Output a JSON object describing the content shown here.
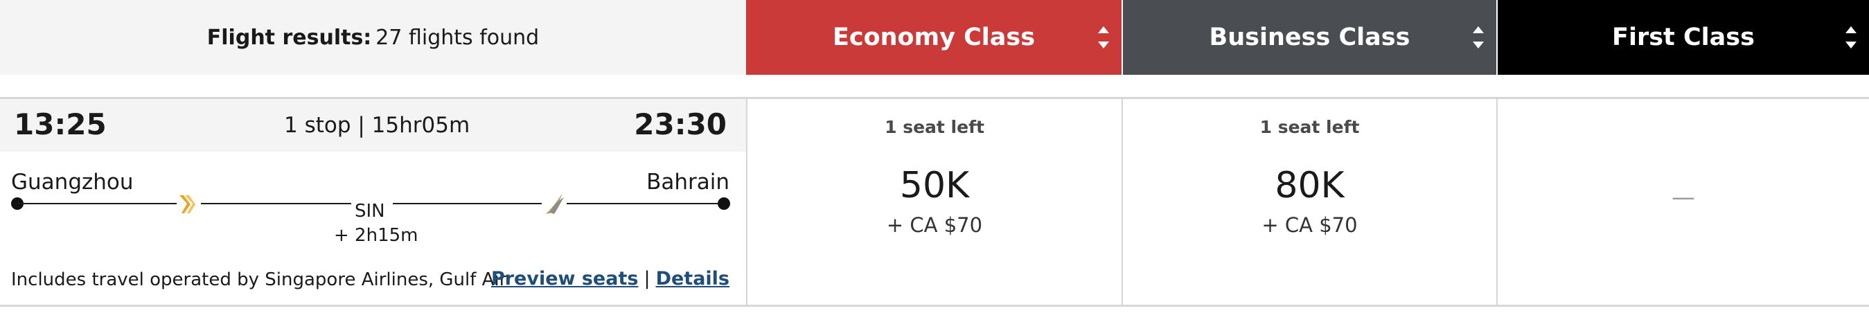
{
  "summary": {
    "label": "Flight results:",
    "count_text": "27 flights found"
  },
  "cabins": [
    {
      "label": "Economy Class",
      "color": "#c93a39"
    },
    {
      "label": "Business Class",
      "color": "#4a4e52"
    },
    {
      "label": "First Class",
      "color": "#000000"
    }
  ],
  "sort_icon": "sort-updown-icon",
  "flight": {
    "departure_time": "13:25",
    "arrival_time": "23:30",
    "stops_duration": "1 stop | 15hr05m",
    "origin": "Guangzhou",
    "destination": "Bahrain",
    "connection": "SIN",
    "layover": "+ 2h15m",
    "operated_by": "Includes travel operated by Singapore Airlines, Gulf Air",
    "preview_seats_label": "Preview seats",
    "separator": "|",
    "details_label": "Details",
    "airline_icons": [
      "singapore-airlines-icon",
      "gulf-air-icon"
    ]
  },
  "fares": {
    "economy": {
      "availability": "1 seat left",
      "points": "50K",
      "cash": "+ CA $70"
    },
    "business": {
      "availability": "1 seat left",
      "points": "80K",
      "cash": "+ CA $70"
    },
    "first": {
      "unavailable": "—"
    }
  }
}
